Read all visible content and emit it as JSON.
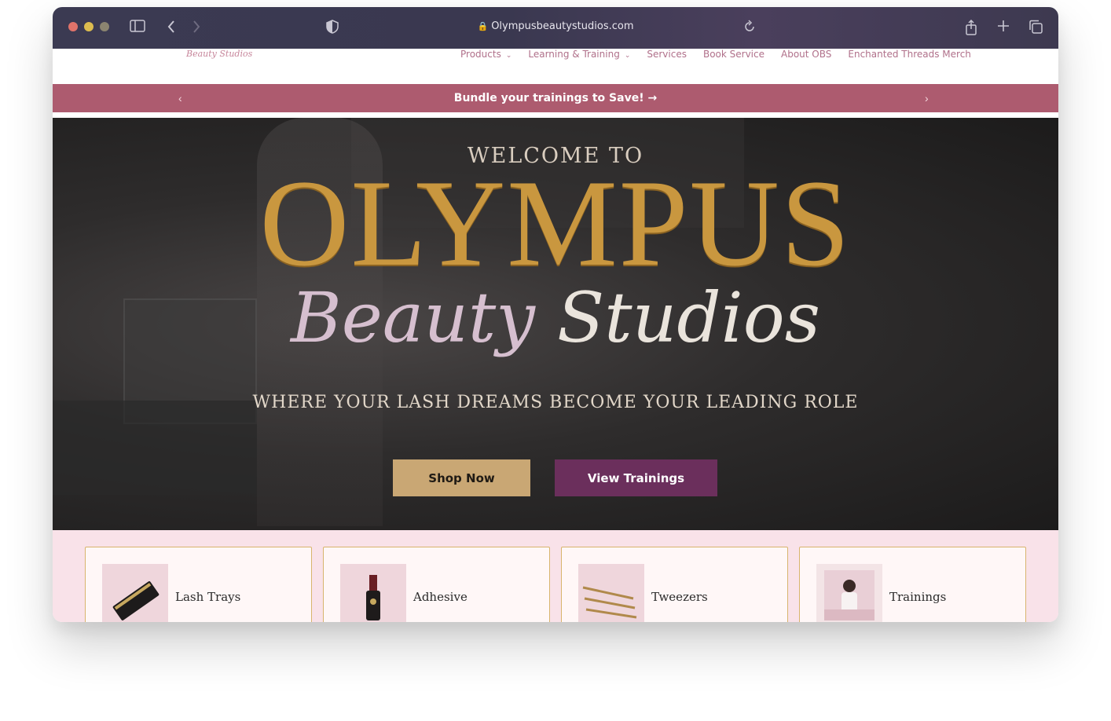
{
  "browser": {
    "url": "Olympusbeautystudios.com",
    "icons": [
      "sidebar-icon",
      "back-icon",
      "forward-icon",
      "shield-icon",
      "lock-icon",
      "reload-icon",
      "share-icon",
      "new-tab-icon",
      "tabs-icon"
    ]
  },
  "site": {
    "logo_script": "Beauty Studios",
    "nav": [
      {
        "label": "Products",
        "dropdown": true
      },
      {
        "label": "Learning & Training",
        "dropdown": true
      },
      {
        "label": "Services",
        "dropdown": false
      },
      {
        "label": "Book Service",
        "dropdown": false
      },
      {
        "label": "About OBS",
        "dropdown": false
      },
      {
        "label": "Enchanted Threads Merch",
        "dropdown": false
      }
    ],
    "announcement": {
      "text": "Bundle your trainings to Save!",
      "arrow": "→",
      "prev": "‹",
      "next": "›"
    },
    "hero": {
      "welcome": "WELCOME TO",
      "brand": "OLYMPUS",
      "subtitle_word1": "Beauty",
      "subtitle_word2": "Studios",
      "tagline": "WHERE YOUR LASH DREAMS BECOME YOUR LEADING ROLE",
      "buttons": {
        "shop": "Shop Now",
        "trainings": "View Trainings"
      }
    },
    "categories": [
      {
        "label": "Lash Trays"
      },
      {
        "label": "Adhesive"
      },
      {
        "label": "Tweezers"
      },
      {
        "label": "Trainings"
      }
    ],
    "colors": {
      "announcement_bg": "#ad5b6f",
      "shop_button": "#c9a774",
      "trainings_button": "#6b2f5c",
      "brand_gold": "#c9973f",
      "categories_bg": "#f9e2e9"
    }
  }
}
